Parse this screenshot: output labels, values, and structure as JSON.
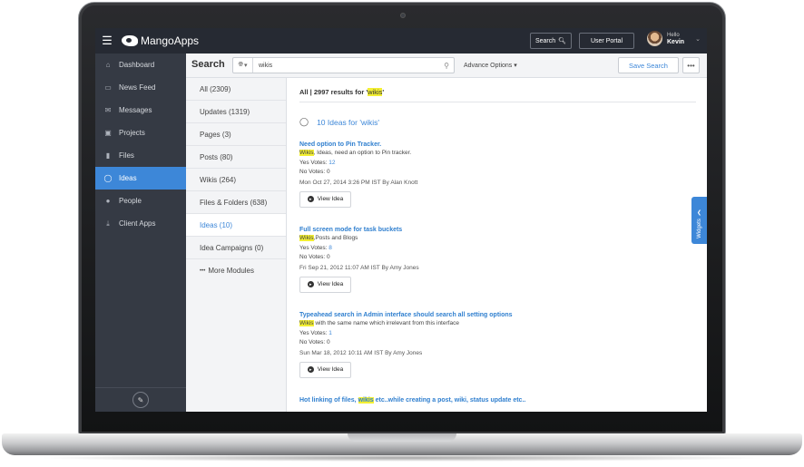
{
  "app": {
    "logo_text": "MangoApps"
  },
  "topbar": {
    "search_label": "Search",
    "user_portal_label": "User Portal",
    "hello_label": "Hello",
    "user_name": "Kevin"
  },
  "sidebar": {
    "items": [
      {
        "label": "Dashboard",
        "icon": "home-icon"
      },
      {
        "label": "News Feed",
        "icon": "inbox-icon"
      },
      {
        "label": "Messages",
        "icon": "envelope-icon"
      },
      {
        "label": "Projects",
        "icon": "briefcase-icon"
      },
      {
        "label": "Files",
        "icon": "file-icon"
      },
      {
        "label": "Ideas",
        "icon": "lightbulb-icon",
        "active": true
      },
      {
        "label": "People",
        "icon": "user-icon"
      },
      {
        "label": "Client Apps",
        "icon": "download-icon"
      }
    ]
  },
  "search": {
    "title": "Search",
    "query": "wikis",
    "advance_options": "Advance Options",
    "save_search": "Save Search"
  },
  "filters": [
    {
      "label": "All (2309)"
    },
    {
      "label": "Updates (1319)"
    },
    {
      "label": "Pages (3)"
    },
    {
      "label": "Posts (80)"
    },
    {
      "label": "Wikis (264)"
    },
    {
      "label": "Files & Folders (638)"
    },
    {
      "label": "Ideas (10)",
      "active": true
    },
    {
      "label": "Idea Campaigns (0)"
    },
    {
      "label": "More Modules"
    }
  ],
  "results": {
    "count_prefix": "All | 2997 results for '",
    "count_term": "wikis",
    "count_suffix": "'",
    "section_title": "10 Ideas for 'wikis'",
    "view_label": "View Idea",
    "ideas": [
      {
        "title": "Need option to Pin Tracker.",
        "snippet_hl": "Wikis",
        "snippet_rest": ", Ideas, need an option to Pin tracker.",
        "yes_label": "Yes Votes: ",
        "yes_votes": "12",
        "no_label": "No Votes: ",
        "no_votes": "0",
        "date": "Mon Oct 27, 2014 3:26 PM IST By Alan Knott"
      },
      {
        "title": "Full screen mode for task buckets",
        "snippet_hl": "Wikis",
        "snippet_rest": ",Posts and Blogs",
        "yes_label": "Yes Votes: ",
        "yes_votes": "8",
        "no_label": "No Votes: ",
        "no_votes": "0",
        "date": "Fri Sep 21, 2012 11:07 AM IST By Amy Jones"
      },
      {
        "title": "Typeahead search in Admin interface should search all setting options",
        "snippet_hl": "Wikis",
        "snippet_rest": " with the same name which irrelevant from this interface",
        "yes_label": "Yes Votes: ",
        "yes_votes": "1",
        "no_label": "No Votes: ",
        "no_votes": "0",
        "date": "Sun Mar 18, 2012 10:11 AM IST By Amy Jones"
      }
    ],
    "last_title_prefix": "Hot linking of files, ",
    "last_title_hl": "wikis",
    "last_title_suffix": " etc..while creating a post, wiki, status update etc.."
  },
  "widgets_label": "Widgets",
  "colors": {
    "accent": "#3d87d8",
    "topbar": "#262a33",
    "sidebar": "#353a44",
    "highlight": "#f3ef33"
  }
}
